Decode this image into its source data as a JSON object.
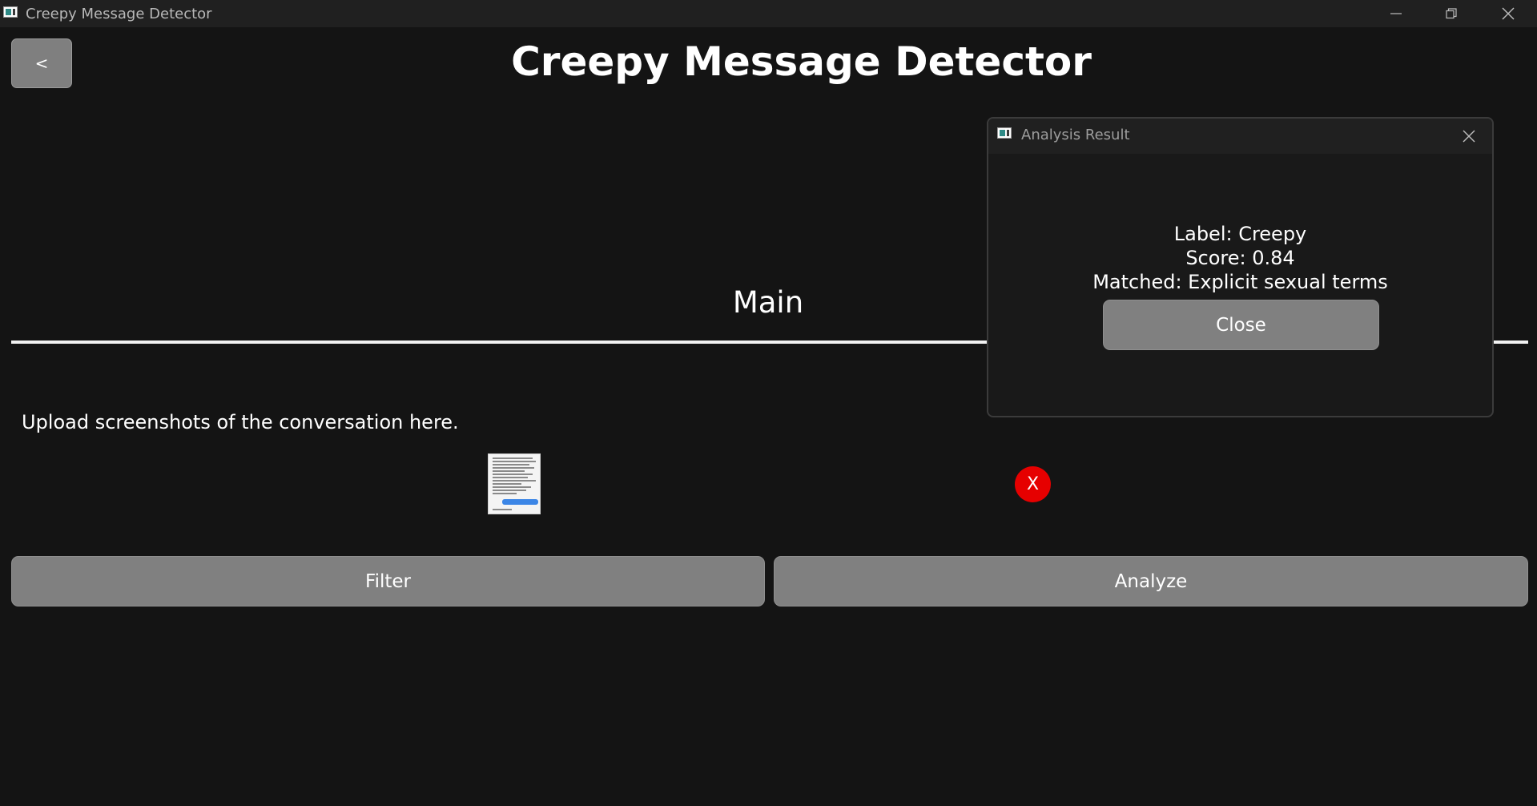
{
  "window": {
    "title": "Creepy Message Detector",
    "controls": [
      "minimize-icon",
      "restore-icon",
      "close-icon"
    ]
  },
  "header": {
    "back_label": "<",
    "title": "Creepy Message Detector"
  },
  "section": {
    "title": "Main"
  },
  "upload": {
    "instructions": "Upload screenshots of the conversation here.",
    "remove_label": "X"
  },
  "actions": {
    "filter_label": "Filter",
    "analyze_label": "Analyze"
  },
  "dialog": {
    "title": "Analysis Result",
    "label_line": "Label: Creepy",
    "score_line": "Score: 0.84",
    "matched_line": "Matched: Explicit sexual terms",
    "close_label": "Close"
  },
  "colors": {
    "background": "#141414",
    "titlebar": "#202020",
    "button": "#808080",
    "remove_button": "#e60000",
    "text": "#ffffff"
  }
}
